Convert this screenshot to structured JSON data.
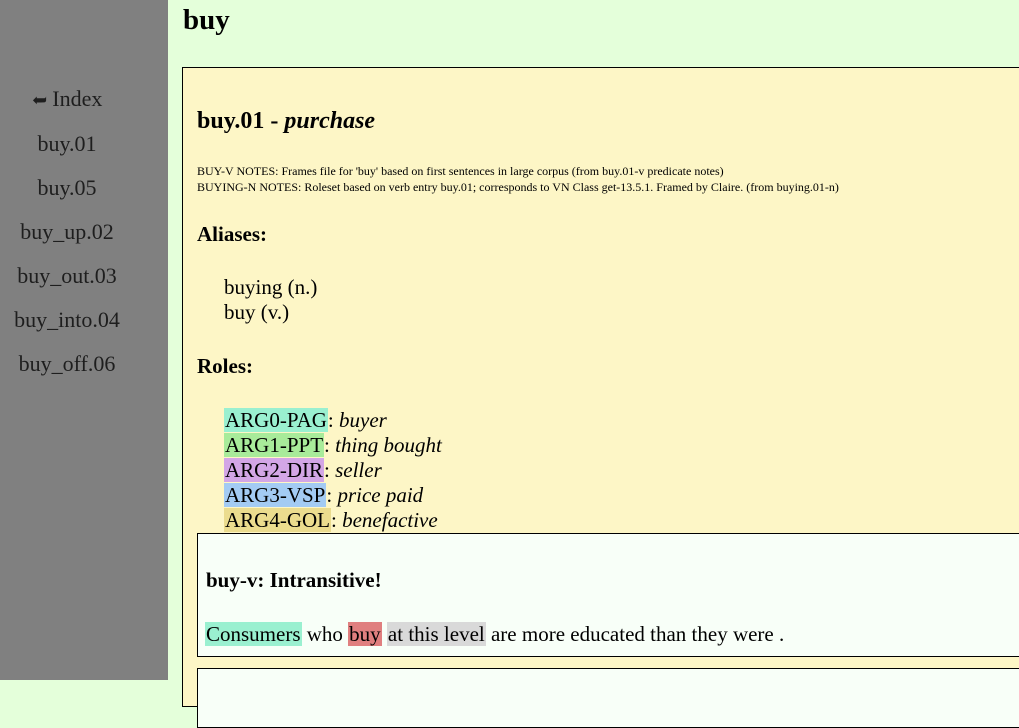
{
  "sidebar": {
    "index_arrow": "➥",
    "index_label": "Index",
    "links": [
      "buy.01",
      "buy.05",
      "buy_up.02",
      "buy_out.03",
      "buy_into.04",
      "buy_off.06"
    ]
  },
  "page": {
    "title": "buy"
  },
  "roleset": {
    "id": "buy.01",
    "separator": " - ",
    "name": "purchase",
    "notes": [
      "BUY-V NOTES: Frames file for 'buy' based on first sentences in large corpus (from buy.01-v predicate notes)",
      "BUYING-N NOTES: Roleset based on verb entry buy.01; corresponds to VN Class get-13.5.1. Framed by Claire. (from buying.01-n)"
    ],
    "aliases_heading": "Aliases:",
    "aliases": [
      "buying (n.)",
      "buy (v.)"
    ],
    "roles_heading": "Roles:",
    "roles": [
      {
        "tag": "ARG0-PAG",
        "desc": "buyer",
        "color": "#9af0d0"
      },
      {
        "tag": "ARG1-PPT",
        "desc": "thing bought",
        "color": "#a8eb9a"
      },
      {
        "tag": "ARG2-DIR",
        "desc": "seller",
        "color": "#d3a6e6"
      },
      {
        "tag": "ARG3-VSP",
        "desc": "price paid",
        "color": "#a3cbf3"
      },
      {
        "tag": "ARG4-GOL",
        "desc": "benefactive",
        "color": "#ebdc8e"
      }
    ]
  },
  "example": {
    "name": "buy-v: Intransitive!",
    "tokens": [
      {
        "text": "Consumers",
        "color": "#9af0d0"
      },
      {
        "text": " who ",
        "color": ""
      },
      {
        "text": "buy",
        "color": "#e07f7f"
      },
      {
        "text": " ",
        "color": ""
      },
      {
        "text": "at this level",
        "color": "#d9d9d9"
      },
      {
        "text": " are more educated than they were .",
        "color": ""
      }
    ]
  }
}
